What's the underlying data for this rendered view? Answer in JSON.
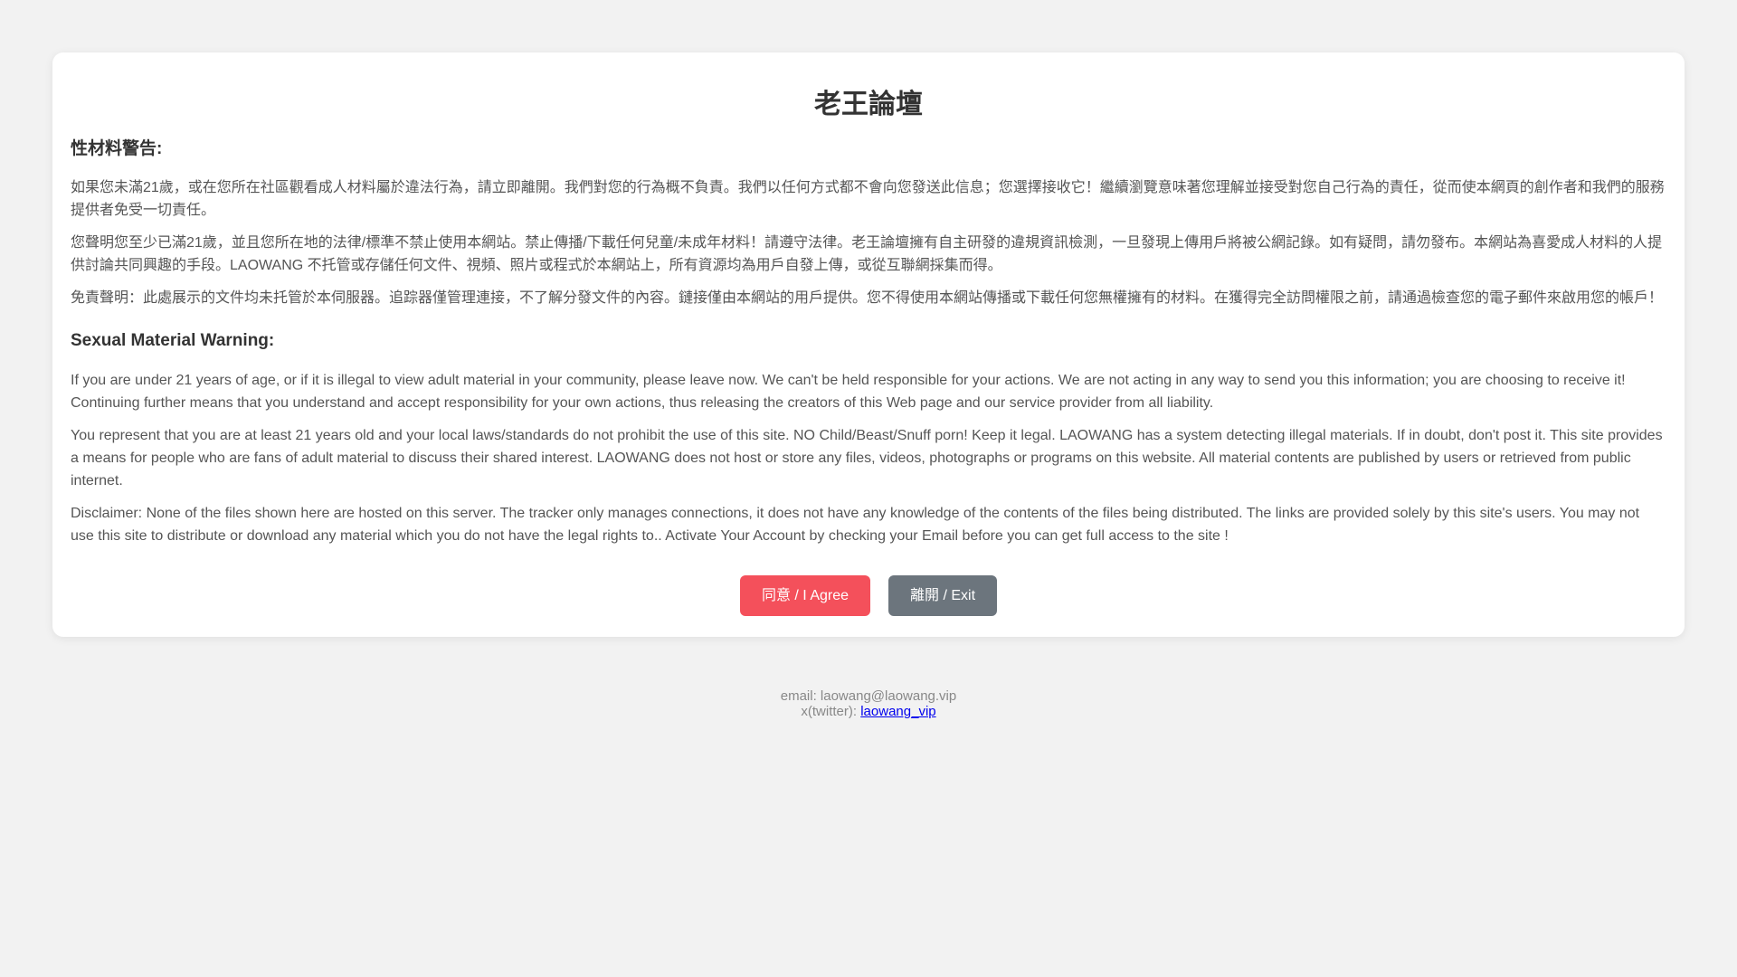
{
  "site": {
    "title": "老王論壇"
  },
  "chinese": {
    "heading": "性材料警告:",
    "paragraphs": [
      "如果您未滿21歲，或在您所在社區觀看成人材料屬於違法行為，請立即離開。我們對您的行為概不負責。我們以任何方式都不會向您發送此信息；您選擇接收它！繼續瀏覽意味著您理解並接受對您自己行為的責任，從而使本網頁的創作者和我們的服務提供者免受一切責任。",
      "您聲明您至少已滿21歲，並且您所在地的法律/標準不禁止使用本網站。禁止傳播/下載任何兒童/未成年材料！請遵守法律。老王論壇擁有自主研發的違規資訊檢測，一旦發現上傳用戶將被公網記錄。如有疑問，請勿發布。本網站為喜愛成人材料的人提供討論共同興趣的手段。LAOWANG 不托管或存儲任何文件、視頻、照片或程式於本網站上，所有資源均為用戶自發上傳，或從互聯網採集而得。",
      "免責聲明：此處展示的文件均未托管於本伺服器。追踪器僅管理連接，不了解分發文件的內容。鏈接僅由本網站的用戶提供。您不得使用本網站傳播或下載任何您無權擁有的材料。在獲得完全訪問權限之前，請通過檢查您的電子郵件來啟用您的帳戶！"
    ]
  },
  "english": {
    "heading": "Sexual Material Warning:",
    "paragraphs": [
      "If you are under 21 years of age, or if it is illegal to view adult material in your community, please leave now. We can't be held responsible for your actions. We are not acting in any way to send you this information; you are choosing to receive it! Continuing further means that you understand and accept responsibility for your own actions, thus releasing the creators of this Web page and our service provider from all liability.",
      "You represent that you are at least 21 years old and your local laws/standards do not prohibit the use of this site. NO Child/Beast/Snuff porn! Keep it legal. LAOWANG has a system detecting illegal materials. If in doubt, don't post it. This site provides a means for people who are fans of adult material to discuss their shared interest. LAOWANG does not host or store any files, videos, photographs or programs on this website. All material contents are published by users or retrieved from public internet.",
      "Disclaimer: None of the files shown here are hosted on this server. The tracker only manages connections, it does not have any knowledge of the contents of the files being distributed. The links are provided solely by this site's users. You may not use this site to distribute or download any material which you do not have the legal rights to.. Activate Your Account by checking your Email before you can get full access to the site !"
    ]
  },
  "buttons": {
    "agree_label": "同意 / I Agree",
    "exit_label": "離開 / Exit"
  },
  "footer": {
    "email_text": "email: laowang@laowang.vip",
    "twitter_prefix": "x(twitter): ",
    "twitter_link": "laowang_vip"
  },
  "colors": {
    "background": "#f2f2f2",
    "card": "#ffffff",
    "agree_button": "#f4505b",
    "exit_button": "#6c757d",
    "link": "#0000ee"
  }
}
